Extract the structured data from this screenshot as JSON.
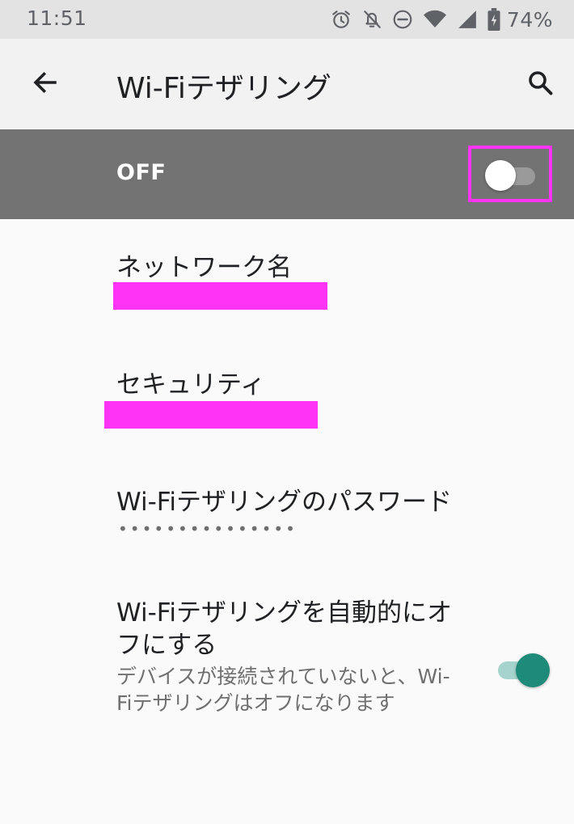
{
  "status_bar": {
    "time": "11:51",
    "battery_text": "74%",
    "icons": [
      "alarm-icon",
      "notifications-off-icon",
      "do-not-disturb-icon",
      "wifi-icon",
      "cellular-signal-icon",
      "battery-charging-icon"
    ]
  },
  "app_bar": {
    "title": "Wi-Fiテザリング",
    "back_icon": "arrow-back-icon",
    "search_icon": "search-icon"
  },
  "master_switch": {
    "label": "OFF",
    "checked": false
  },
  "settings": {
    "network_name": {
      "title": "ネットワーク名"
    },
    "security": {
      "title": "セキュリティ"
    },
    "password": {
      "title": "Wi-Fiテザリングのパスワード",
      "value": "•••••••••••••••"
    },
    "auto_off": {
      "title": "Wi-Fiテザリングを自動的にオフにする",
      "summary": "デバイスが接続されていないと、Wi-Fiテザリングはオフになります",
      "checked": true
    }
  },
  "colors": {
    "status_bar_bg": "#e3e3e3",
    "app_bar_bg": "#f2f2f2",
    "master_bar_bg": "#737373",
    "redaction": "#ff33f5",
    "switch_on_thumb": "#1e8a79",
    "switch_on_track": "#a7d3ce"
  }
}
